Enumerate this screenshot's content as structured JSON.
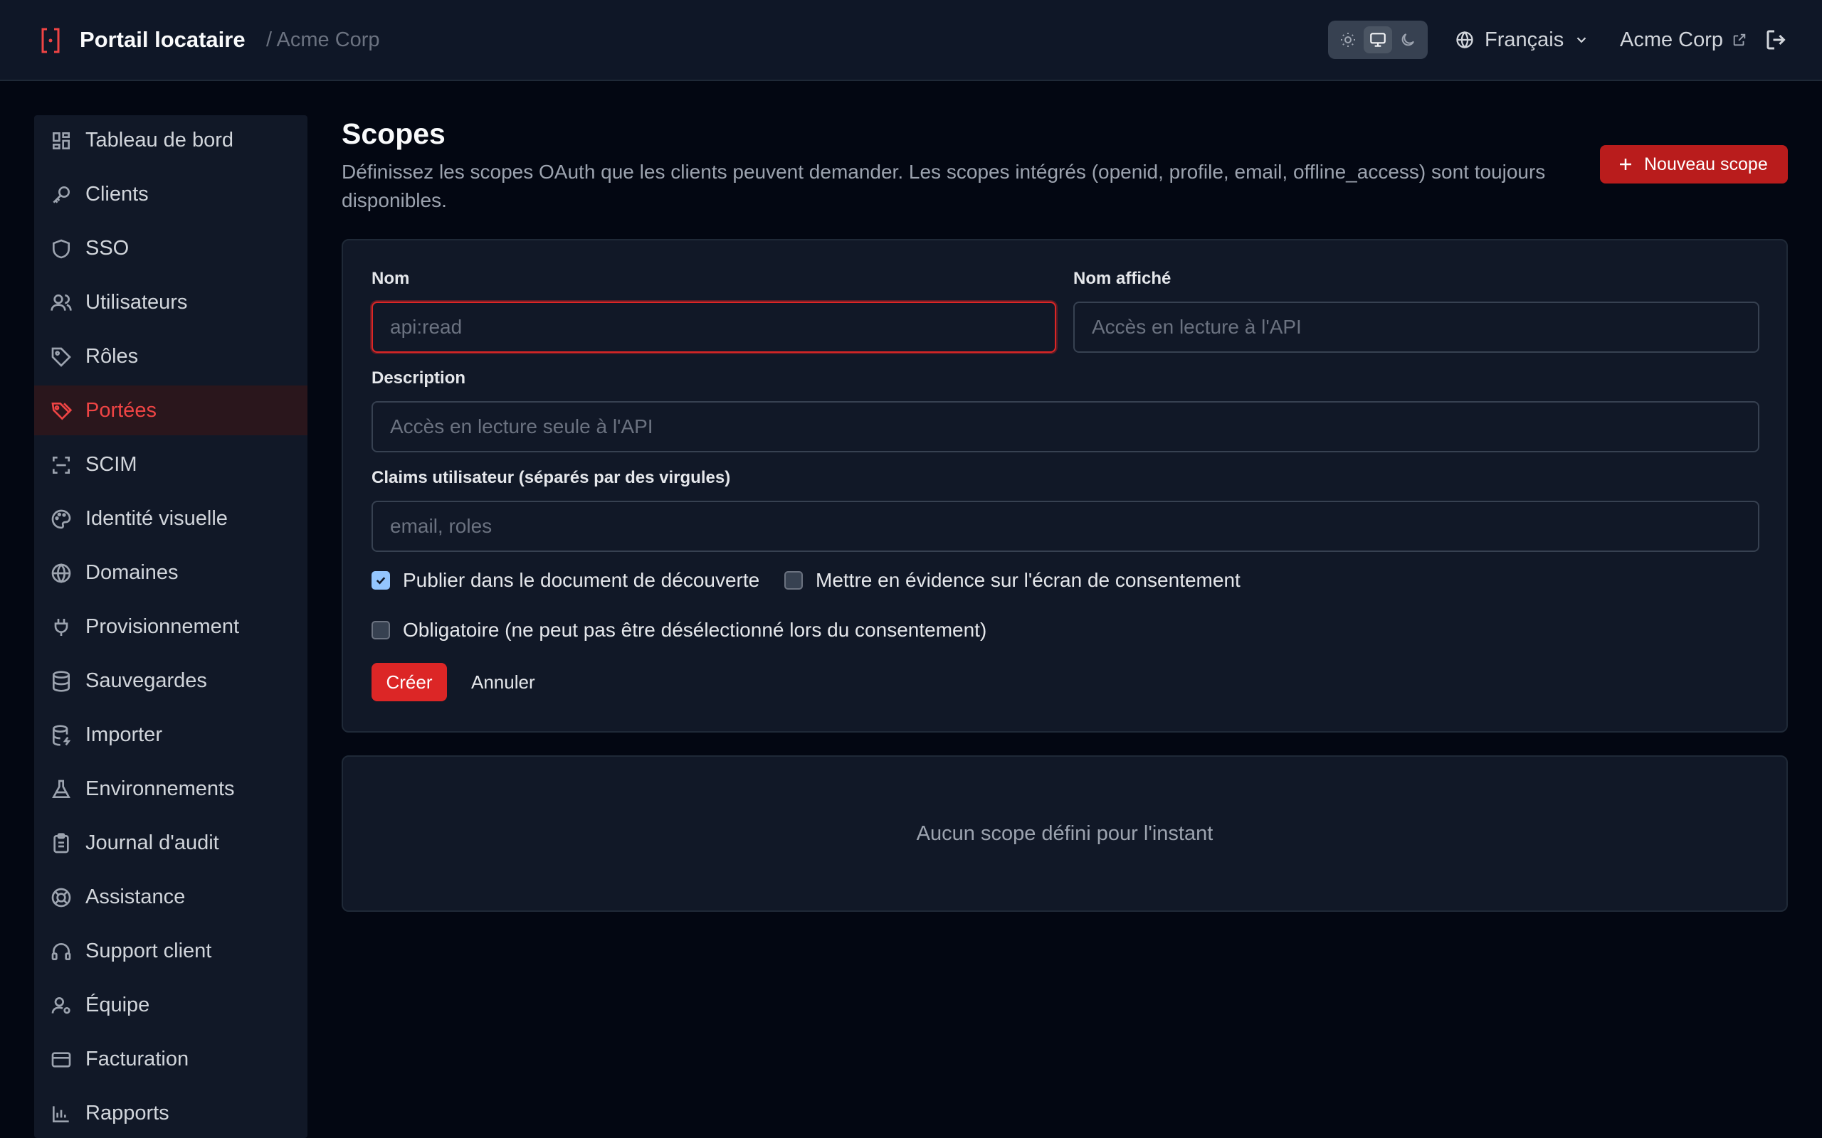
{
  "header": {
    "app_title": "Portail locataire",
    "breadcrumb": "/ Acme Corp",
    "theme_options": [
      "light-icon",
      "monitor-icon",
      "moon-icon"
    ],
    "theme_selected": "monitor-icon",
    "language": "Français",
    "tenant": "Acme Corp"
  },
  "sidebar": {
    "items": [
      {
        "label": "Tableau de bord",
        "icon": "dashboard-icon"
      },
      {
        "label": "Clients",
        "icon": "key-icon"
      },
      {
        "label": "SSO",
        "icon": "shield-icon"
      },
      {
        "label": "Utilisateurs",
        "icon": "users-icon"
      },
      {
        "label": "Rôles",
        "icon": "tag-icon"
      },
      {
        "label": "Portées",
        "icon": "tags-icon",
        "active": true
      },
      {
        "label": "SCIM",
        "icon": "scan-icon"
      },
      {
        "label": "Identité visuelle",
        "icon": "palette-icon"
      },
      {
        "label": "Domaines",
        "icon": "globe-icon"
      },
      {
        "label": "Provisionnement",
        "icon": "plug-icon"
      },
      {
        "label": "Sauvegardes",
        "icon": "database-icon"
      },
      {
        "label": "Importer",
        "icon": "database-import-icon"
      },
      {
        "label": "Environnements",
        "icon": "flask-icon"
      },
      {
        "label": "Journal d'audit",
        "icon": "clipboard-icon"
      },
      {
        "label": "Assistance",
        "icon": "lifebuoy-icon"
      },
      {
        "label": "Support client",
        "icon": "headset-icon"
      },
      {
        "label": "Équipe",
        "icon": "user-gear-icon"
      },
      {
        "label": "Facturation",
        "icon": "credit-card-icon"
      },
      {
        "label": "Rapports",
        "icon": "bar-chart-icon"
      }
    ]
  },
  "main": {
    "title": "Scopes",
    "description": "Définissez les scopes OAuth que les clients peuvent demander. Les scopes intégrés (openid, profile, email, offline_access) sont toujours disponibles.",
    "new_button": "Nouveau scope",
    "form": {
      "name_label": "Nom",
      "name_placeholder": "api:read",
      "name_value": "",
      "display_label": "Nom affiché",
      "display_placeholder": "Accès en lecture à l'API",
      "display_value": "",
      "description_label": "Description",
      "description_placeholder": "Accès en lecture seule à l'API",
      "description_value": "",
      "claims_label": "Claims utilisateur (séparés par des virgules)",
      "claims_placeholder": "email, roles",
      "claims_value": "",
      "publish_label": "Publier dans le document de découverte",
      "publish_checked": true,
      "highlight_label": "Mettre en évidence sur l'écran de consentement",
      "highlight_checked": false,
      "required_label": "Obligatoire (ne peut pas être désélectionné lors du consentement)",
      "required_checked": false,
      "create_button": "Créer",
      "cancel_button": "Annuler"
    },
    "empty_state": "Aucun scope défini pour l'instant"
  },
  "colors": {
    "accent": "#dc2626",
    "background": "#030712",
    "panel": "#111827",
    "active_nav_text": "#ef4444"
  }
}
